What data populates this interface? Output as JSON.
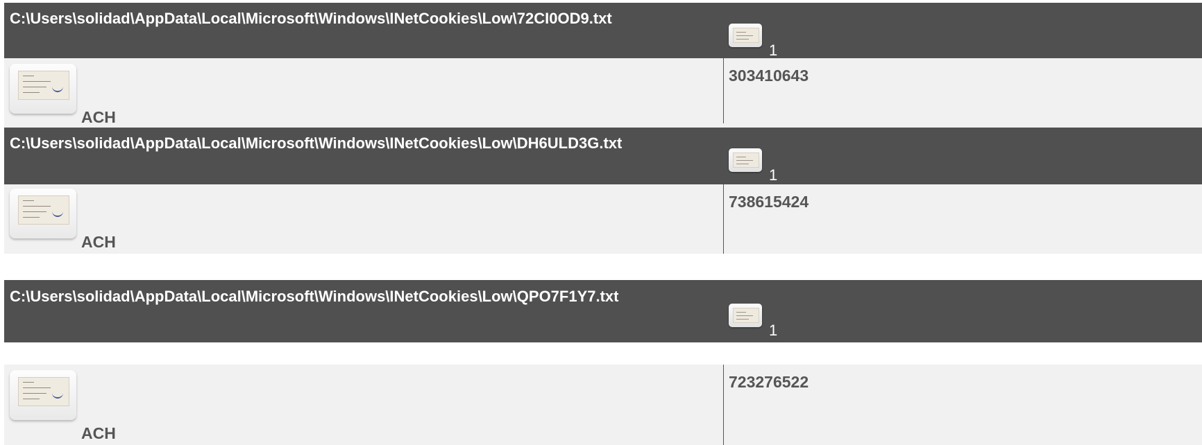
{
  "entries": [
    {
      "path": "C:\\Users\\solidad\\AppData\\Local\\Microsoft\\Windows\\INetCookies\\Low\\72CI0OD9.txt",
      "count": "1",
      "method": "ACH",
      "account": "303410643"
    },
    {
      "path": "C:\\Users\\solidad\\AppData\\Local\\Microsoft\\Windows\\INetCookies\\Low\\DH6ULD3G.txt",
      "count": "1",
      "method": "ACH",
      "account": "738615424"
    },
    {
      "path": "C:\\Users\\solidad\\AppData\\Local\\Microsoft\\Windows\\INetCookies\\Low\\QPO7F1Y7.txt",
      "count": "1",
      "method": "ACH",
      "account": "723276522"
    }
  ],
  "icons": {
    "thumb": "check-thumbnail-icon",
    "check": "check-icon"
  },
  "colors": {
    "header_bg": "#505050",
    "row_bg": "#f1f1f1",
    "header_text": "#ffffff",
    "row_text": "#555555"
  }
}
